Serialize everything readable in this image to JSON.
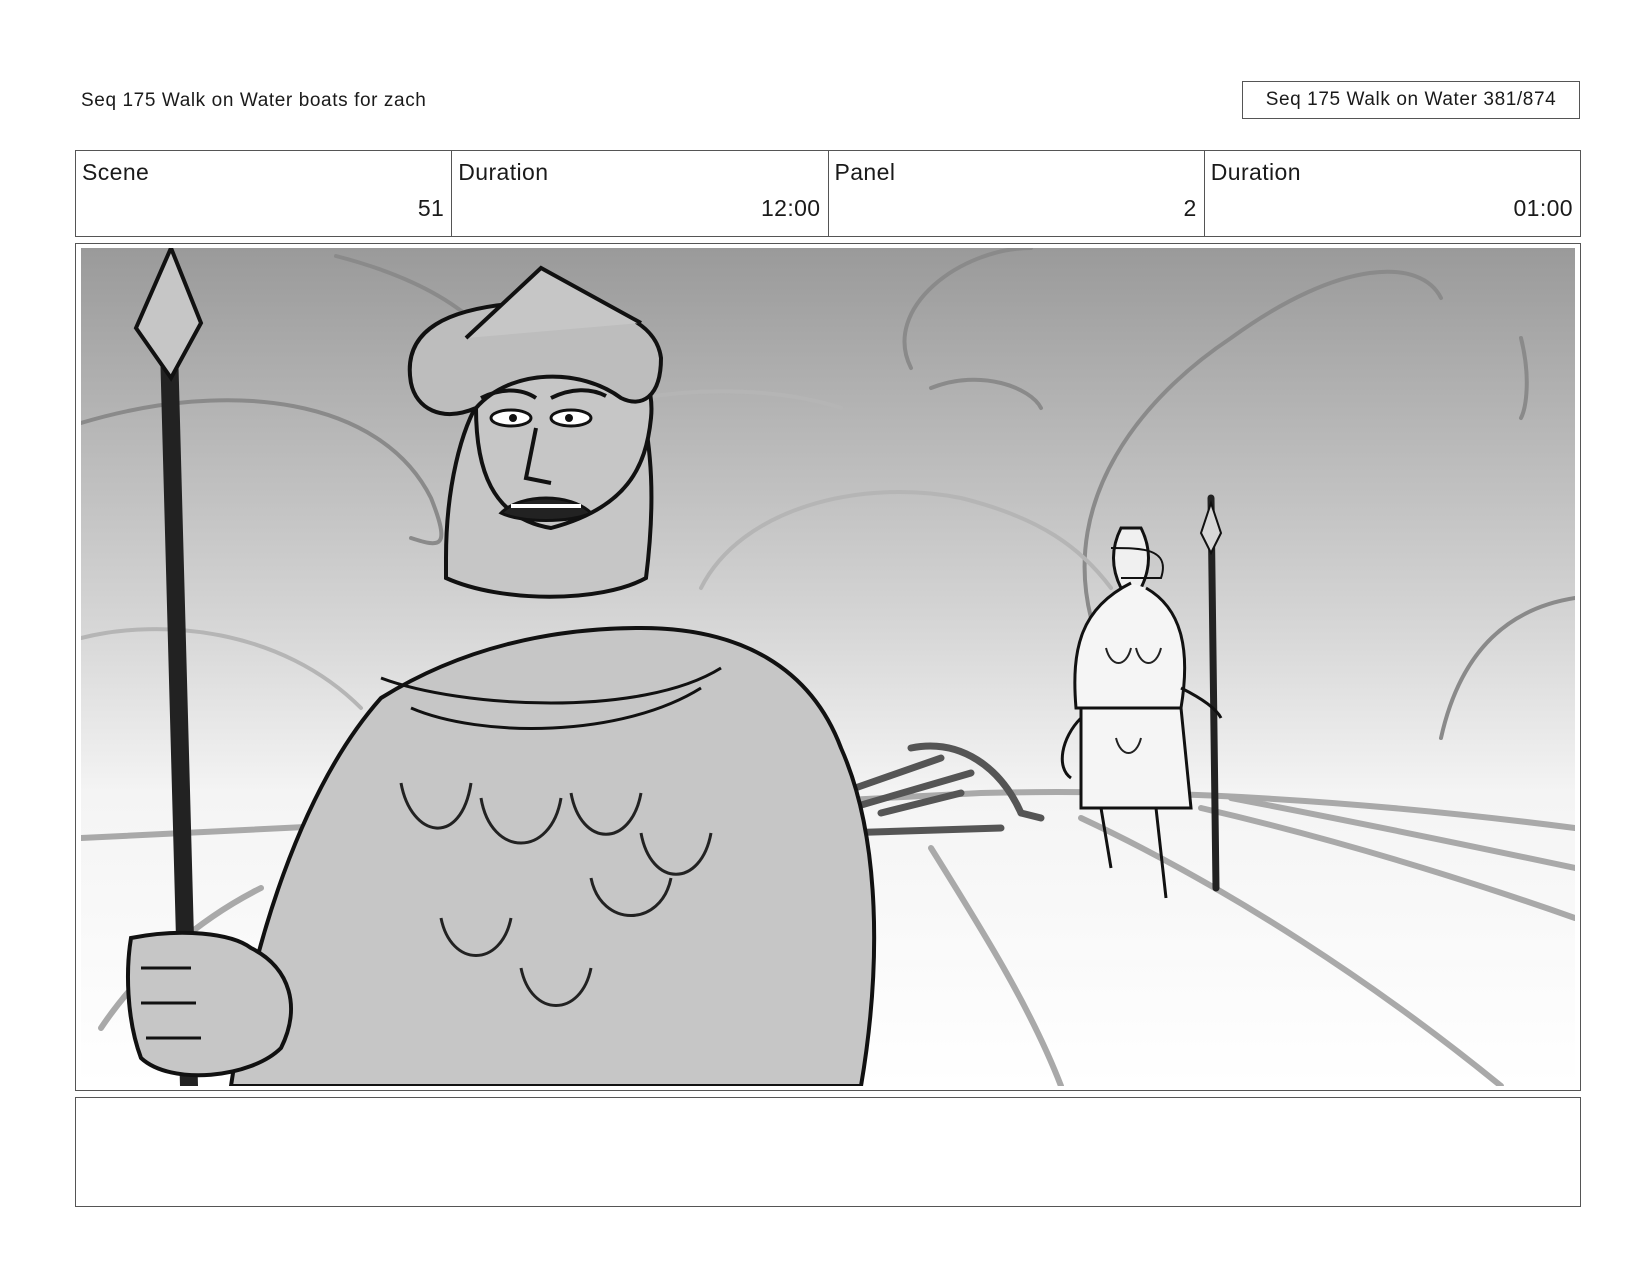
{
  "header": {
    "left_title": "Seq 175 Walk on Water  boats for zach",
    "right_title": "Seq 175 Walk on Water 381/874"
  },
  "info": {
    "scene_label": "Scene",
    "scene_value": "51",
    "scene_duration_label": "Duration",
    "scene_duration_value": "12:00",
    "panel_label": "Panel",
    "panel_value": "2",
    "panel_duration_label": "Duration",
    "panel_duration_value": "01:00"
  },
  "notes": {
    "text": ""
  }
}
